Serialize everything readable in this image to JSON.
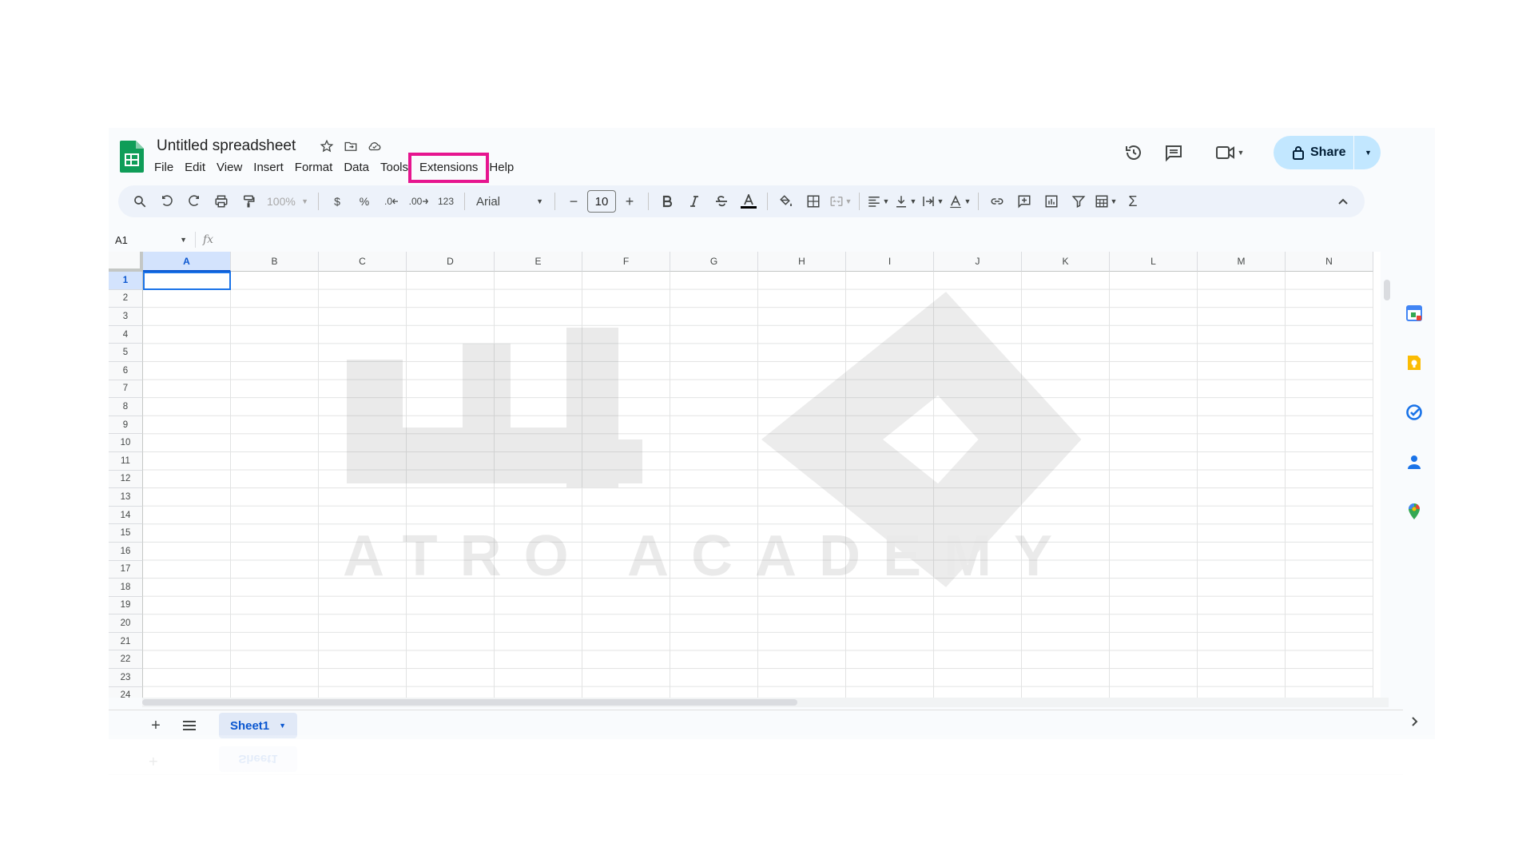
{
  "app": {
    "title": "Untitled spreadsheet"
  },
  "menu": [
    "File",
    "Edit",
    "View",
    "Insert",
    "Format",
    "Data",
    "Tools",
    "Extensions",
    "Help"
  ],
  "header_icons": [
    "star-icon",
    "move-to-folder-icon",
    "cloud-saved-icon",
    "history-icon",
    "comments-icon",
    "meet-icon"
  ],
  "share": {
    "label": "Share"
  },
  "toolbar": {
    "zoom": "100%",
    "currency": "$",
    "percent": "%",
    "decrease_decimal": ".0",
    "increase_decimal": ".00",
    "number_format": "123",
    "font": "Arial",
    "font_size": "10",
    "minus": "−",
    "plus": "+"
  },
  "formula_bar": {
    "name_box": "A1",
    "fx": "fx"
  },
  "grid": {
    "columns": [
      "A",
      "B",
      "C",
      "D",
      "E",
      "F",
      "G",
      "H",
      "I",
      "J",
      "K",
      "L",
      "M",
      "N"
    ],
    "rows": [
      "1",
      "2",
      "3",
      "4",
      "5",
      "6",
      "7",
      "8",
      "9",
      "10",
      "11",
      "12",
      "13",
      "14",
      "15",
      "16",
      "17",
      "18",
      "19",
      "20",
      "21",
      "22",
      "23",
      "24"
    ],
    "selected_cell": "A1"
  },
  "sheets": [
    {
      "name": "Sheet1",
      "active": true
    }
  ],
  "watermark": {
    "text": "ATRO ACADEMY"
  },
  "side_panel": [
    "calendar-icon",
    "keep-icon",
    "tasks-icon",
    "contacts-icon",
    "maps-icon"
  ],
  "colors": {
    "accent": "#0b57d0",
    "share_bg": "#c2e7ff",
    "highlight": "#e6158f",
    "toolbar_bg": "#edf2fa"
  }
}
